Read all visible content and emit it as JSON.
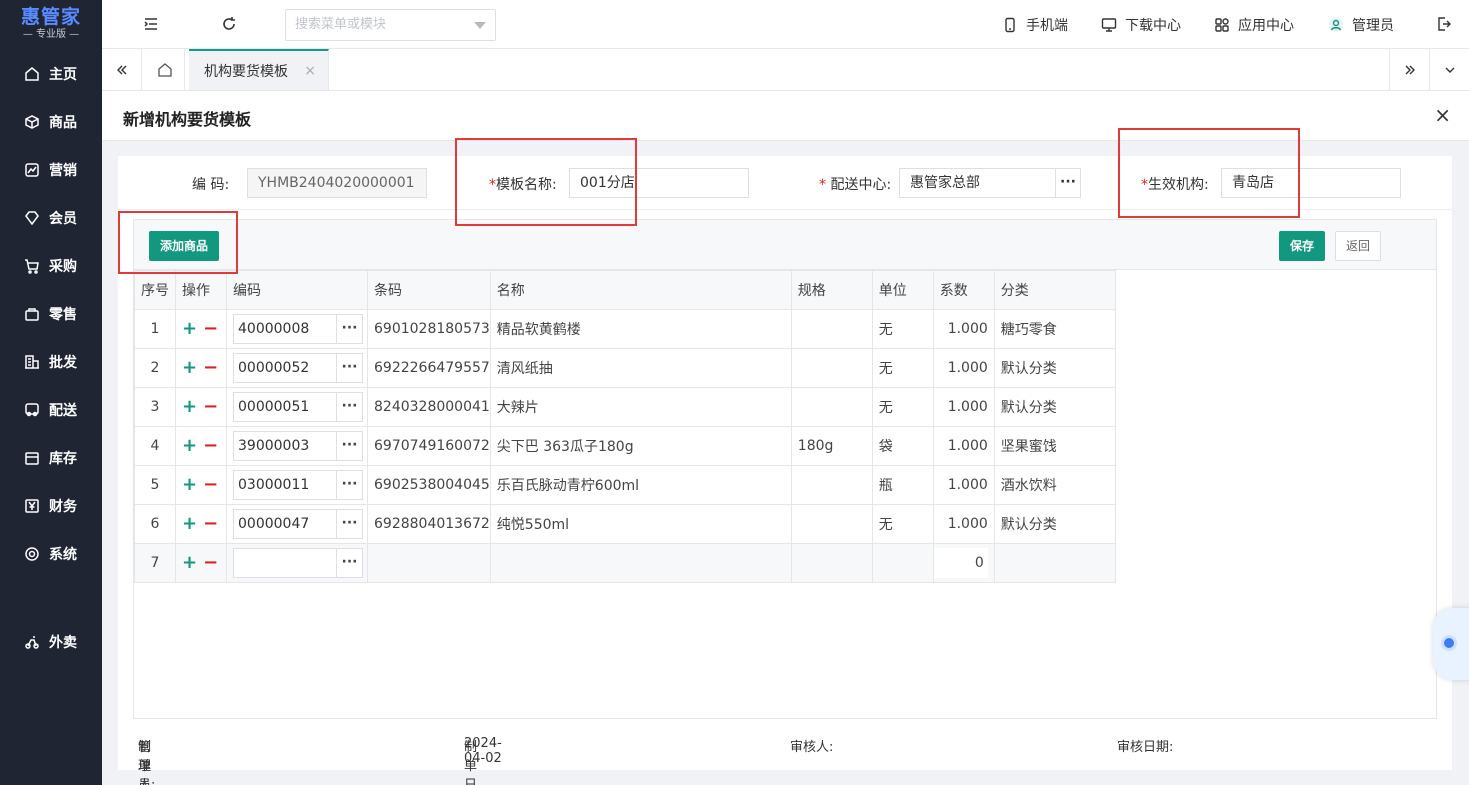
{
  "brand": {
    "name": "惠管家",
    "edition": "专业版"
  },
  "sidebar": {
    "items": [
      {
        "label": "主页",
        "icon": "home-icon"
      },
      {
        "label": "商品",
        "icon": "box-icon"
      },
      {
        "label": "营销",
        "icon": "chart-icon"
      },
      {
        "label": "会员",
        "icon": "diamond-icon"
      },
      {
        "label": "采购",
        "icon": "cart-icon"
      },
      {
        "label": "零售",
        "icon": "bag-icon"
      },
      {
        "label": "批发",
        "icon": "building-icon"
      },
      {
        "label": "配送",
        "icon": "truck-icon"
      },
      {
        "label": "库存",
        "icon": "warehouse-icon"
      },
      {
        "label": "财务",
        "icon": "yen-icon"
      },
      {
        "label": "系统",
        "icon": "gear-icon"
      },
      {
        "label": "外卖",
        "icon": "scooter-icon"
      }
    ]
  },
  "topbar": {
    "search_placeholder": "搜索菜单或模块",
    "mobile": "手机端",
    "download": "下载中心",
    "apps": "应用中心",
    "user": "管理员"
  },
  "tabs": {
    "active": "机构要货模板"
  },
  "dialog": {
    "title": "新增机构要货模板",
    "form": {
      "code_label": "编 码:",
      "code_value": "YHMB2404020000001",
      "template_name_label": "模板名称:",
      "template_name_value": "001分店",
      "dc_label": "配送中心:",
      "dc_value": "惠管家总部",
      "org_label": "生效机构:",
      "org_value": "青岛店"
    },
    "toolbar": {
      "add": "添加商品",
      "save": "保存",
      "back": "返回"
    },
    "columns": [
      "序号",
      "操作",
      "编码",
      "条码",
      "名称",
      "规格",
      "单位",
      "系数",
      "分类"
    ],
    "rows": [
      {
        "no": "1",
        "code": "40000008",
        "barcode": "6901028180573",
        "name": "精品软黄鹤楼",
        "spec": "",
        "unit": "无",
        "coef": "1.000",
        "category": "糖巧零食"
      },
      {
        "no": "2",
        "code": "00000052",
        "barcode": "6922266479557",
        "name": "清风纸抽",
        "spec": "",
        "unit": "无",
        "coef": "1.000",
        "category": "默认分类"
      },
      {
        "no": "3",
        "code": "00000051",
        "barcode": "8240328000041",
        "name": "大辣片",
        "spec": "",
        "unit": "无",
        "coef": "1.000",
        "category": "默认分类"
      },
      {
        "no": "4",
        "code": "39000003",
        "barcode": "6970749160072",
        "name": "尖下巴 363瓜子180g",
        "spec": "180g",
        "unit": "袋",
        "coef": "1.000",
        "category": "坚果蜜饯"
      },
      {
        "no": "5",
        "code": "03000011",
        "barcode": "6902538004045",
        "name": "乐百氏脉动青柠600ml",
        "spec": "",
        "unit": "瓶",
        "coef": "1.000",
        "category": "酒水饮料"
      },
      {
        "no": "6",
        "code": "00000047",
        "barcode": "6928804013672",
        "name": "纯悦550ml",
        "spec": "",
        "unit": "无",
        "coef": "1.000",
        "category": "默认分类"
      }
    ],
    "new_row": {
      "no": "7",
      "coef": "0"
    },
    "footer": {
      "creator_label": "制单人:",
      "creator_value": "管理员",
      "date_label": "制单日期:",
      "date_value": "2024-04-02",
      "auditor_label": "审核人:",
      "audit_date_label": "审核日期:"
    }
  },
  "colors": {
    "accent": "#11987f",
    "sidebar_bg": "#1f2532",
    "highlight": "#e03a3a",
    "required": "#e02020"
  }
}
